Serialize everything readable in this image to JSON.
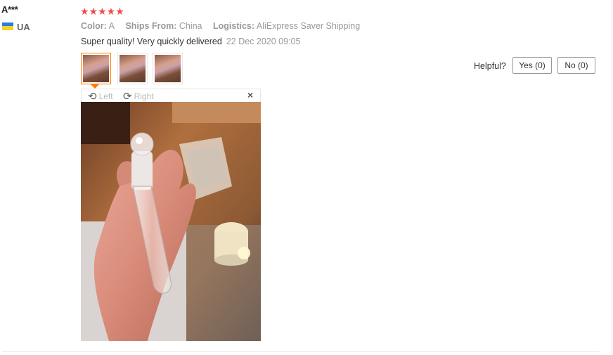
{
  "reviewer": {
    "name": "A***",
    "country": "UA",
    "flag_colors": [
      "#2a7dd6",
      "#f6d22a"
    ]
  },
  "rating": {
    "stars": 5,
    "display": "★★★★★",
    "color": "#ef4b4b"
  },
  "attributes": [
    {
      "label": "Color:",
      "value": "A"
    },
    {
      "label": "Ships From:",
      "value": "China"
    },
    {
      "label": "Logistics:",
      "value": "AliExpress Saver Shipping"
    }
  ],
  "review": {
    "text": "Super quality! Very quickly delivered",
    "date": "22 Dec 2020 09:05"
  },
  "thumbnails": {
    "count": 3,
    "active_index": 0
  },
  "viewer": {
    "rotate_left_label": "Left",
    "rotate_right_label": "Right",
    "rotate_left_icon": "rotate-left-icon",
    "rotate_right_icon": "rotate-right-icon",
    "close_icon": "close-icon",
    "close_glyph": "×"
  },
  "helpful": {
    "label": "Helpful?",
    "yes_label": "Yes (0)",
    "no_label": "No (0)"
  },
  "colors": {
    "accent": "#ff7a00"
  }
}
